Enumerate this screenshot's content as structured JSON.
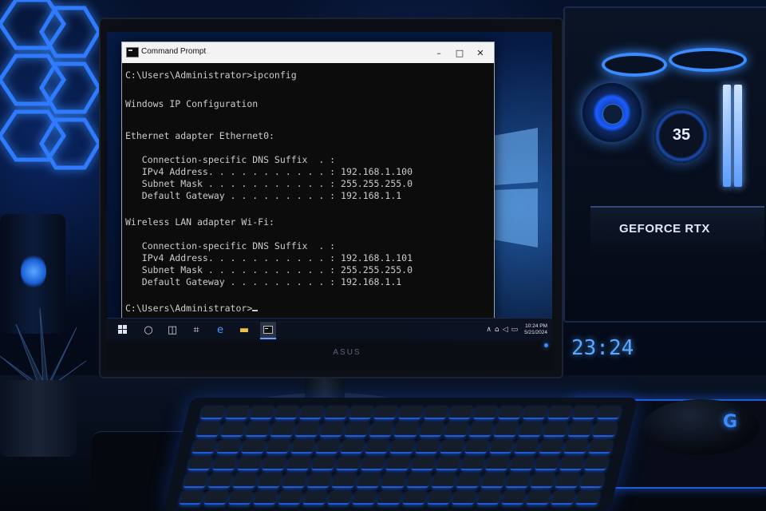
{
  "cmd_window": {
    "title": "Command Prompt",
    "title_icon": "terminal-icon",
    "controls": {
      "minimize": "–",
      "maximize": "□",
      "close": "✕"
    }
  },
  "console": {
    "lines": [
      "C:\\Users\\Administrator>ipconfig",
      "Windows IP Configuration",
      "Ethernet adapter Ethernet0:",
      "   Connection-specific DNS Suffix  . :",
      "   IPv4 Address. . . . . . . . . . . : 192.168.1.100",
      "   Subnet Mask . . . . . . . . . . . : 255.255.255.0",
      "   Default Gateway . . . . . . . . . : 192.168.1.1",
      "Wireless LAN adapter Wi-Fi:",
      "   Connection-specific DNS Suffix  . :",
      "   IPv4 Address. . . . . . . . . . . : 192.168.1.101",
      "   Subnet Mask . . . . . . . . . . . : 255.255.255.0",
      "   Default Gateway . . . . . . . . . : 192.168.1.1",
      "C:\\Users\\Administrator>"
    ]
  },
  "taskbar": {
    "icons": [
      "windows-start-icon",
      "search-icon",
      "task-view-icon",
      "widgets-icon",
      "edge-icon",
      "file-explorer-icon",
      "command-prompt-icon"
    ],
    "clock": {
      "time": "10:24 PM",
      "date": "5/21/2024"
    }
  },
  "monitor": {
    "brand": "ASUS"
  },
  "scene": {
    "gpu_label": "GEFORCE RTX",
    "pump_temp": "35",
    "desk_clock": "23:24"
  },
  "colors": {
    "accent": "#3a8cff",
    "console_bg": "#0c0c0c",
    "console_text": "#cccccc",
    "titlebar": "#f3f3f3"
  }
}
